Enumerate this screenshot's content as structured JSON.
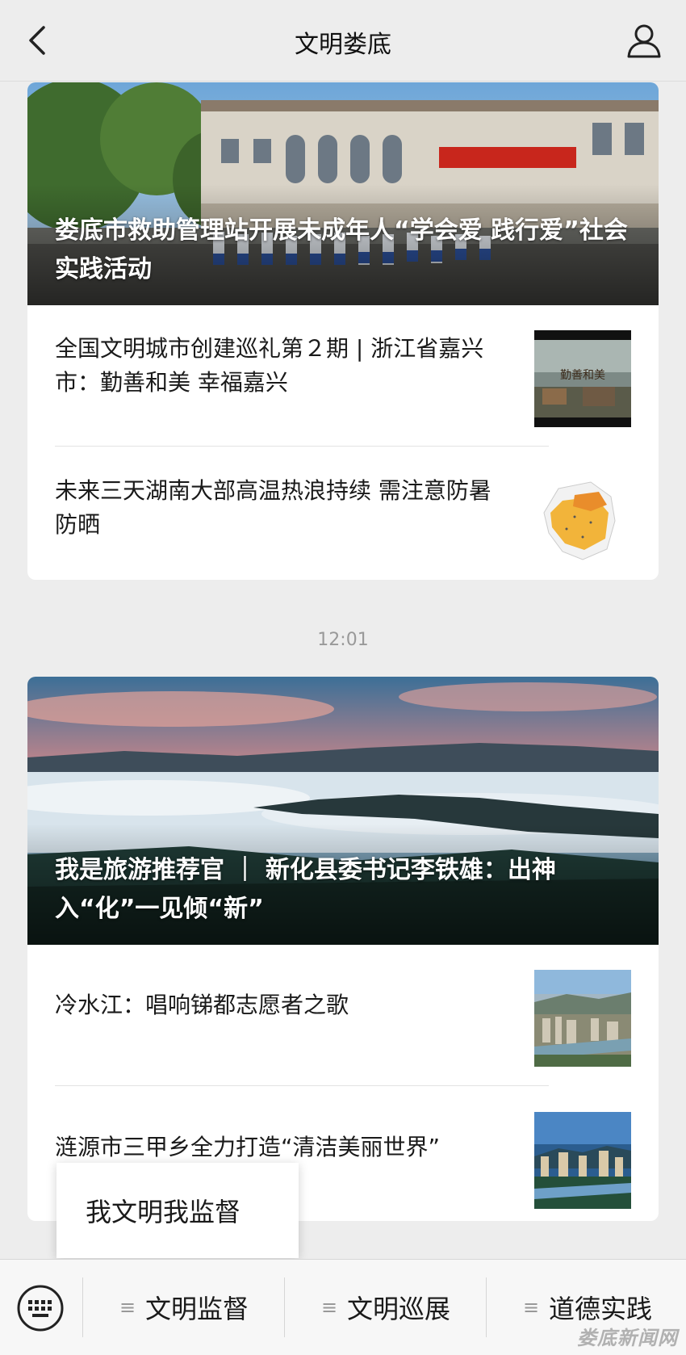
{
  "header": {
    "title": "文明娄底",
    "back_icon": "chevron-left-icon",
    "profile_icon": "person-icon"
  },
  "groups": [
    {
      "hero_title": "娄底市救助管理站开展未成年人“学会爱 践行爱”社会实践活动",
      "items": [
        {
          "title": "全国文明城市创建巡礼第２期 | 浙江省嘉兴市：勤善和美 幸福嘉兴",
          "thumb_text": "勤善和美"
        },
        {
          "title": "未来三天湖南大部高温热浪持续 需注意防暑防晒"
        }
      ]
    },
    {
      "hero_title": "我是旅游推荐官 ｜ 新化县委书记李铁雄：出神入“化”一见倾“新”",
      "items": [
        {
          "title": "冷水江：唱响锑都志愿者之歌"
        },
        {
          "title": "涟源市三甲乡全力打造“清洁美丽世界”"
        }
      ]
    }
  ],
  "timestamp": "12:01",
  "popup_menu": {
    "item": "我文明我监督"
  },
  "bottom_menu": {
    "keyboard_icon": "keyboard-icon",
    "items": [
      "文明监督",
      "文明巡展",
      "道德实践"
    ]
  },
  "watermark": "娄底新闻网"
}
